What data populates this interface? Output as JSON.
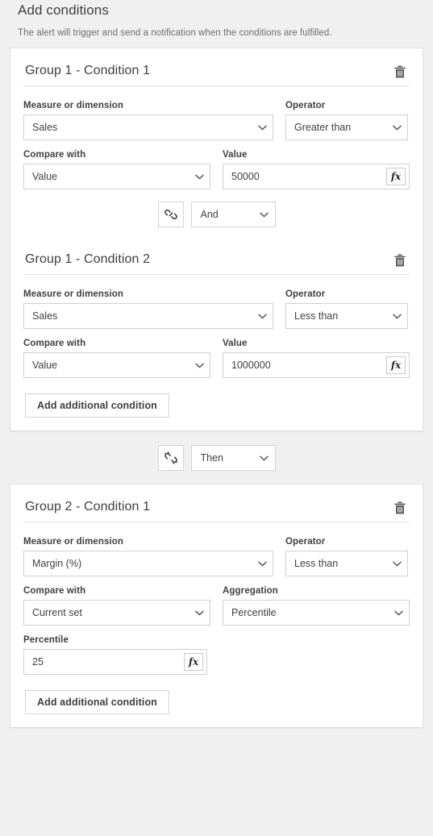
{
  "header": {
    "title": "Add conditions",
    "subtitle": "The alert will trigger and send a notification when the conditions are fulfilled."
  },
  "labels": {
    "measure_or_dimension": "Measure or dimension",
    "operator": "Operator",
    "compare_with": "Compare with",
    "value": "Value",
    "aggregation": "Aggregation",
    "percentile": "Percentile"
  },
  "buttons": {
    "add_additional_condition": "Add additional condition",
    "delete_icon": "trash-icon",
    "expression_icon": "fx",
    "link_icon": "link-icon",
    "unlink_icon": "broken-link-icon",
    "chevron_icon": "chevron-down-icon"
  },
  "groups": [
    {
      "id": "group-1",
      "conditions": [
        {
          "title": "Group 1 - Condition 1",
          "measure": "Sales",
          "operator": "Greater than",
          "compare_with": "Value",
          "value": "50000"
        },
        {
          "title": "Group 1 - Condition 2",
          "measure": "Sales",
          "operator": "Less than",
          "compare_with": "Value",
          "value": "1000000"
        }
      ],
      "inner_connector": {
        "icon": "link-icon",
        "logic": "And"
      },
      "add_button": "Add additional condition"
    },
    {
      "id": "group-2",
      "conditions": [
        {
          "title": "Group 2 - Condition 1",
          "measure": "Margin (%)",
          "operator": "Less than",
          "compare_with": "Current set",
          "aggregation": "Percentile",
          "percentile": "25"
        }
      ],
      "add_button": "Add additional condition"
    }
  ],
  "outer_connector": {
    "icon": "broken-link-icon",
    "logic": "Then"
  },
  "colors": {
    "page_background": "#f0f0f0",
    "card_background": "#ffffff",
    "border": "#d0d0d0",
    "text": "#404040",
    "muted_text": "#6e6e6e"
  }
}
